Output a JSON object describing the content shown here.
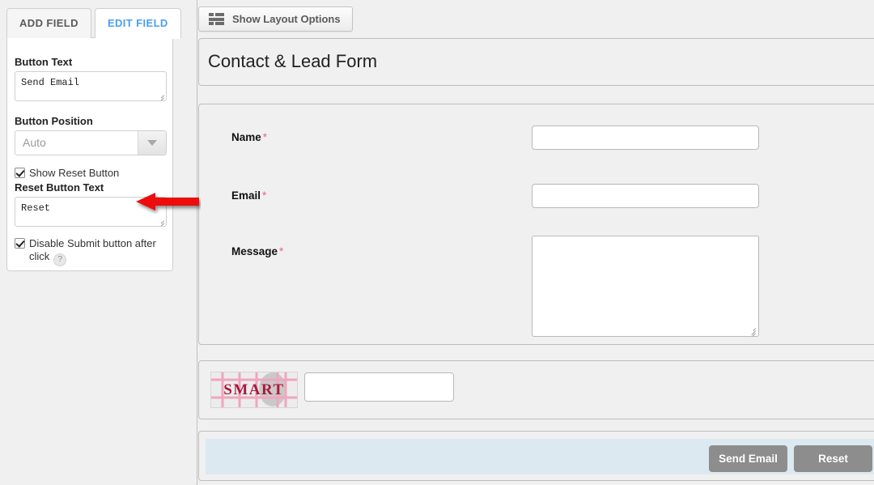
{
  "sidebar": {
    "tabs": [
      {
        "label": "ADD FIELD",
        "active": false
      },
      {
        "label": "EDIT FIELD",
        "active": true
      }
    ],
    "button_text": {
      "label": "Button Text",
      "value": "Send Email"
    },
    "button_position": {
      "label": "Button Position",
      "value": "Auto"
    },
    "show_reset": {
      "label": "Show Reset Button",
      "checked": true
    },
    "reset_button_text": {
      "label": "Reset Button Text",
      "value": "Reset"
    },
    "disable_submit": {
      "label": "Disable Submit button after click",
      "checked": true,
      "help": "?"
    }
  },
  "toolbar": {
    "layout_options_label": "Show Layout Options"
  },
  "form": {
    "title": "Contact & Lead Form",
    "required_marker": "*",
    "fields": [
      {
        "label": "Name",
        "required": true,
        "type": "text",
        "value": ""
      },
      {
        "label": "Email",
        "required": true,
        "type": "text",
        "value": ""
      },
      {
        "label": "Message",
        "required": true,
        "type": "textarea",
        "value": ""
      }
    ],
    "captcha": {
      "text": "SMART",
      "input_value": ""
    },
    "actions": {
      "submit_label": "Send Email",
      "reset_label": "Reset"
    }
  },
  "annotation": {
    "arrow": "red-left-arrow pointing at Reset Button Text field"
  },
  "colors": {
    "page_background": "#f0f0f1",
    "active_tab_text": "#4a9ff5",
    "required_asterisk": "#e8647d",
    "button_background": "#8d8d8d",
    "footer_strip": "#dde9f0",
    "captcha_text": "#a61b3c",
    "annotation_arrow": "#ee1111"
  }
}
